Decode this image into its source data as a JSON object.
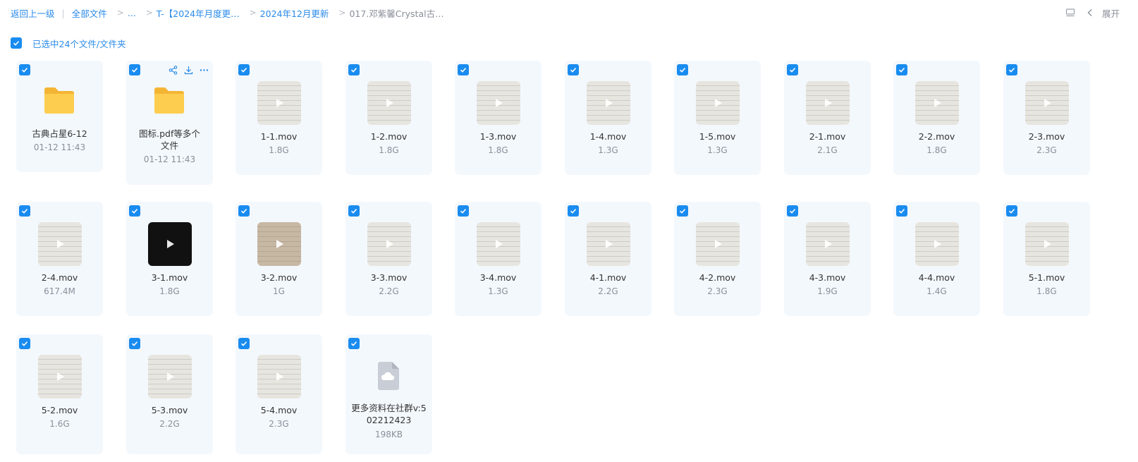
{
  "breadcrumb": {
    "back": "返回上一级",
    "all_files": "全部文件",
    "ellipsis": "...",
    "item1": "T-【2024年月度更…",
    "item2": "2024年12月更新",
    "current": "017.邓紫馨Crystal古…"
  },
  "toolbar": {
    "expand_label": "展开"
  },
  "selection": {
    "label": "已选中24个文件/文件夹"
  },
  "files": [
    {
      "name": "古典占星6-12",
      "meta": "01-12 11:43",
      "kind": "folder"
    },
    {
      "name": "图标.pdf等多个文件",
      "meta": "01-12 11:43",
      "kind": "folder"
    },
    {
      "name": "1-1.mov",
      "meta": "1.8G",
      "kind": "video"
    },
    {
      "name": "1-2.mov",
      "meta": "1.8G",
      "kind": "video"
    },
    {
      "name": "1-3.mov",
      "meta": "1.8G",
      "kind": "video"
    },
    {
      "name": "1-4.mov",
      "meta": "1.3G",
      "kind": "video"
    },
    {
      "name": "1-5.mov",
      "meta": "1.3G",
      "kind": "video"
    },
    {
      "name": "2-1.mov",
      "meta": "2.1G",
      "kind": "video"
    },
    {
      "name": "2-2.mov",
      "meta": "1.8G",
      "kind": "video"
    },
    {
      "name": "2-3.mov",
      "meta": "2.3G",
      "kind": "video"
    },
    {
      "name": "2-4.mov",
      "meta": "617.4M",
      "kind": "video"
    },
    {
      "name": "3-1.mov",
      "meta": "1.8G",
      "kind": "video-dark"
    },
    {
      "name": "3-2.mov",
      "meta": "1G",
      "kind": "video-brown"
    },
    {
      "name": "3-3.mov",
      "meta": "2.2G",
      "kind": "video"
    },
    {
      "name": "3-4.mov",
      "meta": "1.3G",
      "kind": "video"
    },
    {
      "name": "4-1.mov",
      "meta": "2.2G",
      "kind": "video"
    },
    {
      "name": "4-2.mov",
      "meta": "2.3G",
      "kind": "video"
    },
    {
      "name": "4-3.mov",
      "meta": "1.9G",
      "kind": "video"
    },
    {
      "name": "4-4.mov",
      "meta": "1.4G",
      "kind": "video"
    },
    {
      "name": "5-1.mov",
      "meta": "1.8G",
      "kind": "video"
    },
    {
      "name": "5-2.mov",
      "meta": "1.6G",
      "kind": "video"
    },
    {
      "name": "5-3.mov",
      "meta": "2.2G",
      "kind": "video"
    },
    {
      "name": "5-4.mov",
      "meta": "2.3G",
      "kind": "video"
    },
    {
      "name": "更多资料在社群v:502212423",
      "meta": "198KB",
      "kind": "cloud"
    }
  ],
  "icons": {
    "folder": "folder-icon",
    "video": "play-icon",
    "cloud": "cloud-file-icon",
    "checkbox": "checkbox-checked-icon"
  },
  "colors": {
    "accent": "#1a8cf0",
    "card_bg": "#f3f8fd",
    "folder": "#fcc94a"
  }
}
